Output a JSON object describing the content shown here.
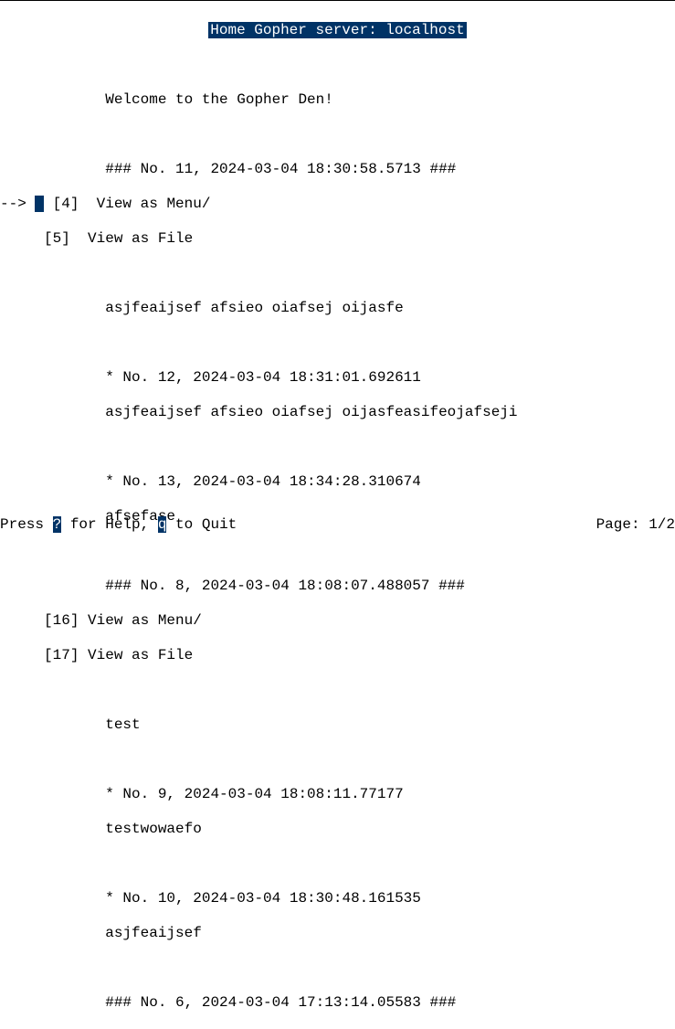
{
  "title": "Home Gopher server: localhost",
  "indent_text": "            ",
  "welcome": "Welcome to the Gopher Den!",
  "entry11_header": "### No. 11, 2024-03-04 18:30:58.5713 ###",
  "arrow_prefix": "--> ",
  "cursor_char": " ",
  "link4_prefix": " [4]  ",
  "link4_label": "View as Menu/",
  "link5_prefix": "     [5]  ",
  "link5_label": "View as File",
  "entry11_body": "asjfeaijsef afsieo oiafsej oijasfe",
  "entry12_header": "* No. 12, 2024-03-04 18:31:01.692611",
  "entry12_body": "asjfeaijsef afsieo oiafsej oijasfeasifeojafseji",
  "entry13_header": "* No. 13, 2024-03-04 18:34:28.310674",
  "entry13_body": "afsefase",
  "entry8_header": "### No. 8, 2024-03-04 18:08:07.488057 ###",
  "link16_prefix": "     [16] ",
  "link16_label": "View as Menu/",
  "link17_prefix": "     [17] ",
  "link17_label": "View as File",
  "entry8_body": "test",
  "entry9_header": "* No. 9, 2024-03-04 18:08:11.77177",
  "entry9_body": "testwowaefo",
  "entry10_header": "* No. 10, 2024-03-04 18:30:48.161535",
  "entry10_body": "asjfeaijsef",
  "entry6_header": "### No. 6, 2024-03-04 17:13:14.05583 ###",
  "status_press": "Press ",
  "status_help_key": "?",
  "status_help_text": " for Help, ",
  "status_quit_key": "q",
  "status_quit_text": " to Quit",
  "status_page": "Page: 1/2"
}
